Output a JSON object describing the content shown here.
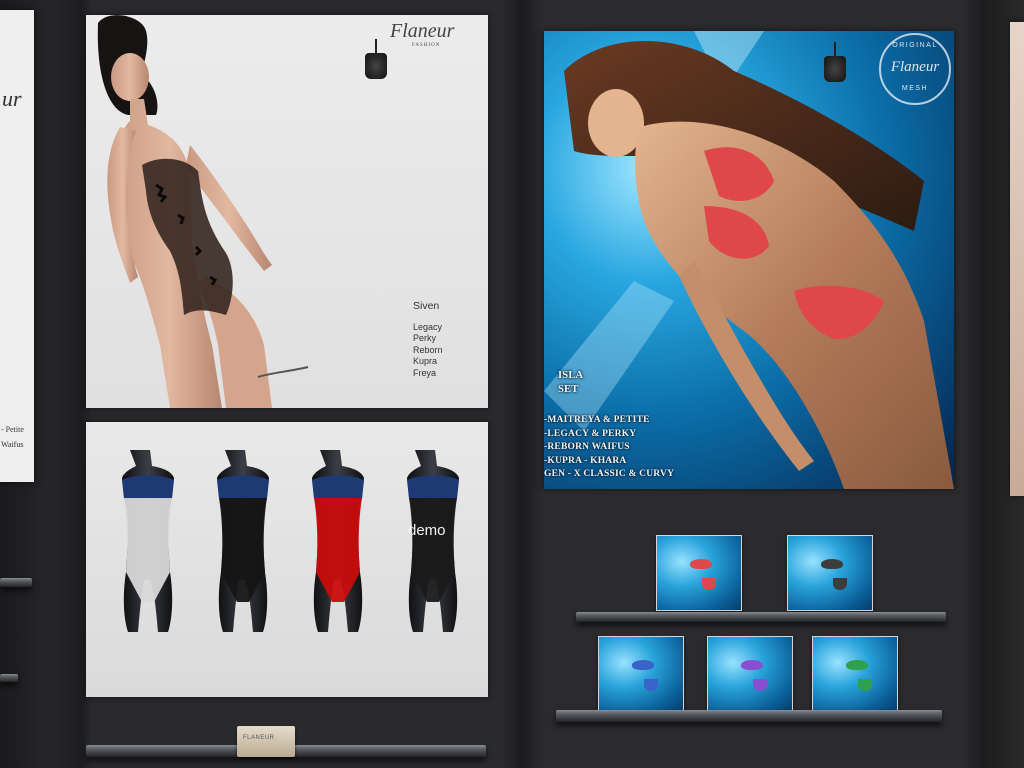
{
  "left_poster": {
    "fragment_brand": "ur",
    "fragment_line1": "- Petite",
    "fragment_line2": "Waifus"
  },
  "siven_poster": {
    "brand_name": "Flaneur",
    "brand_sub": "FASHION",
    "product_title": "Siven",
    "body_lines": [
      "Legacy",
      "Perky",
      "Reborn",
      "Kupra",
      "Freya"
    ]
  },
  "mannequin_poster": {
    "colors": [
      "#d8d8d8",
      "#151515",
      "#c80d0d",
      "#1a1a1a"
    ],
    "demo_label": "demo"
  },
  "isla_poster": {
    "seal_top": "ORIGINAL",
    "seal_mid": "Flaneur",
    "seal_bottom": "MESH",
    "title": "ISLA SET",
    "body_lines": [
      "-MAITREYA & PETITE",
      "-LEGACY & PERKY",
      "-REBORN WAIFUS",
      "-KUPRA - KHARA",
      "GEN - X CLASSIC & CURVY"
    ]
  },
  "vendors": {
    "top_row": [
      {
        "bikini_color": "#e0474a"
      },
      {
        "bikini_color": "#3c3c3c"
      }
    ],
    "bottom_row": [
      {
        "bikini_color": "#3a63c9"
      },
      {
        "bikini_color": "#8a4fd0"
      },
      {
        "bikini_color": "#2fa14a"
      }
    ]
  },
  "small_box": {
    "label": "FLANEUR"
  }
}
